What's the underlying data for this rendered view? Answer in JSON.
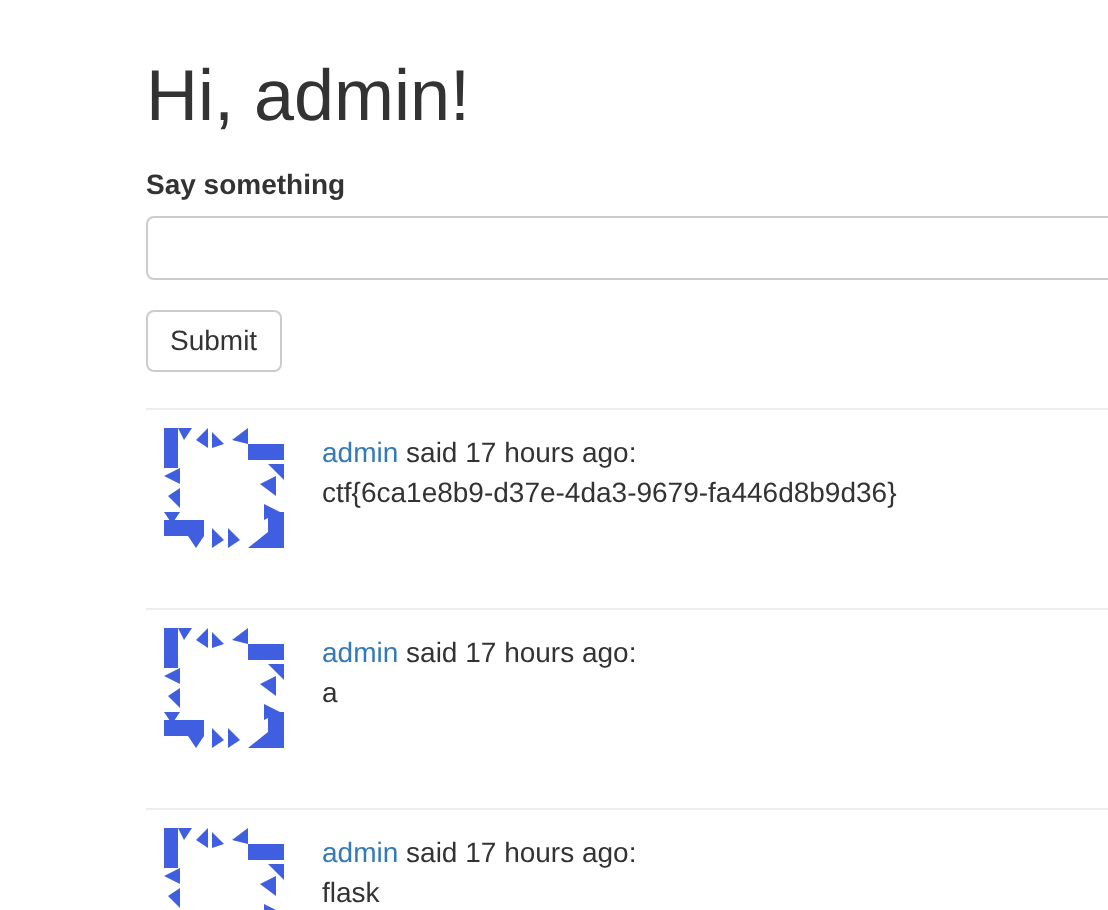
{
  "heading": "Hi, admin!",
  "form": {
    "label": "Say something",
    "submit": "Submit"
  },
  "posts": [
    {
      "author": "admin",
      "meta": "said 17 hours ago:",
      "body": "ctf{6ca1e8b9-d37e-4da3-9679-fa446d8b9d36}"
    },
    {
      "author": "admin",
      "meta": "said 17 hours ago:",
      "body": "a"
    },
    {
      "author": "admin",
      "meta": "said 17 hours ago:",
      "body": "flask"
    }
  ]
}
